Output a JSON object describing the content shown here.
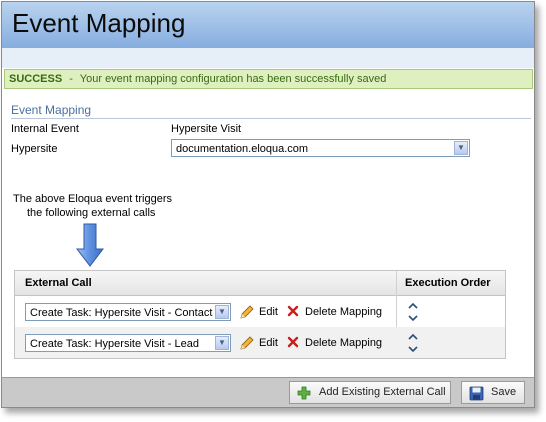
{
  "title": "Event Mapping",
  "success": {
    "label": "SUCCESS",
    "separator": "-",
    "message": "Your event mapping configuration has been successfully saved"
  },
  "section": {
    "title": "Event Mapping"
  },
  "form": {
    "internal_event_label": "Internal Event",
    "internal_event_value": "Hypersite Visit",
    "hypersite_label": "Hypersite",
    "hypersite_value": "documentation.eloqua.com"
  },
  "description": {
    "line1": "The above Eloqua event triggers",
    "line2": "the following external calls"
  },
  "table": {
    "headers": {
      "external_call": "External Call",
      "execution_order": "Execution Order"
    },
    "rows": [
      {
        "selected": "Create Task: Hypersite Visit - Contact",
        "edit": "Edit",
        "delete": "Delete Mapping"
      },
      {
        "selected": "Create Task: Hypersite Visit - Lead",
        "edit": "Edit",
        "delete": "Delete Mapping"
      }
    ]
  },
  "buttons": {
    "add_external_call": "Add Existing External Call",
    "save": "Save"
  },
  "icons": [
    "down-arrow-icon",
    "pencil-icon",
    "delete-x-icon",
    "up-down-chevrons-icon",
    "add-plus-icon",
    "save-disk-icon"
  ],
  "colors": {
    "title_bar": "#9fc1e8",
    "success_bg": "#dff0c0",
    "success_text": "#386a14",
    "section_title": "#49709d"
  }
}
